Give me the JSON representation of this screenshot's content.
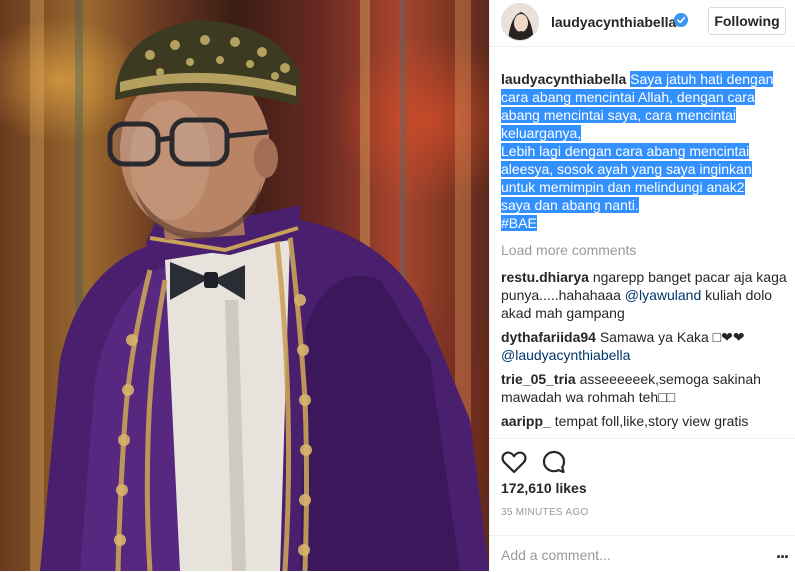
{
  "post": {
    "image_alt": "Photo of a man in a purple embroidered jacket, songkok and glasses",
    "username": "laudyacynthiabella",
    "follow_label": "Following",
    "caption_user": "laudyacynthiabella",
    "caption_lines": [
      "Saya jatuh hati dengan",
      "cara abang mencintai Allah, dengan cara",
      "abang mencintai saya, cara mencintai",
      "keluarganya,",
      "Lebih lagi dengan cara abang mencintai",
      "aleesya, sosok ayah yang saya inginkan",
      "untuk memimpin dan melindungi anak2",
      "saya dan abang nanti.",
      "#BAE"
    ],
    "load_more": "Load more comments",
    "comments": [
      {
        "user": "restu.dhiarya",
        "text": "ngarepp banget pacar aja kaga punya.....hahahaaa",
        "mention": "@lyawuland",
        "text_after": "kuliah dolo akad mah gampang"
      },
      {
        "user": "dythafariida94",
        "text": "Samawa ya Kaka □❤❤",
        "mention": "@laudyacynthiabella",
        "text_after": ""
      },
      {
        "user": "trie_05_tria",
        "text": "asseeeeeek,semoga sakinah mawadah wa rohmah teh□□",
        "mention": "",
        "text_after": ""
      },
      {
        "user": "aaripp_",
        "text": "tempat foll,like,story view gratis",
        "mention": "",
        "text_after": ""
      }
    ],
    "likes": "172,610 likes",
    "timestamp": "35 MINUTES AGO",
    "add_comment_placeholder": "Add a comment...",
    "more_label": "..."
  },
  "icons": {
    "like": "heart-icon",
    "comment": "comment-icon",
    "verified": "verified-badge-icon",
    "more": "more-options-icon"
  },
  "colors": {
    "highlight": "#3390ff",
    "text": "#262626",
    "muted": "#999999",
    "mention": "#003569",
    "verified": "#3897f0"
  }
}
